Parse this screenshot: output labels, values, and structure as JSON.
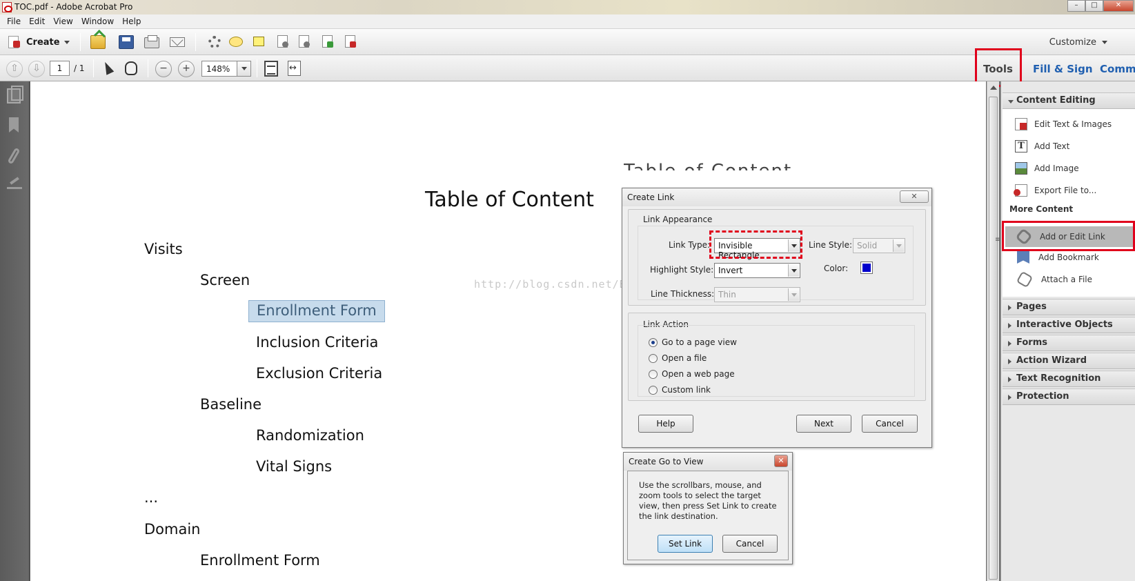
{
  "window": {
    "title": "TOC.pdf - Adobe Acrobat Pro"
  },
  "menu": [
    "File",
    "Edit",
    "View",
    "Window",
    "Help"
  ],
  "toolbar": {
    "create_label": "Create",
    "customize_label": "Customize",
    "icons": [
      "open-folder-icon",
      "save-icon",
      "print-icon",
      "email-icon",
      "settings-icon",
      "comment-icon",
      "highlight-icon",
      "combine-icon",
      "review-icon",
      "share-icon",
      "sign-icon"
    ]
  },
  "nav": {
    "page_current": "1",
    "page_total": "/ 1",
    "zoom": "148%"
  },
  "pane_tabs": {
    "tools": "Tools",
    "fill_sign": "Fill & Sign",
    "comment": "Comm"
  },
  "document": {
    "title": "Table of Content",
    "ghost_heading": "Table of Content",
    "watermark": "http://blog.csdn.net/Bowen_LT",
    "entries": [
      {
        "text": "Visits",
        "level": 0
      },
      {
        "text": "Screen",
        "level": 1
      },
      {
        "text": "Enrollment Form",
        "level": 2,
        "highlighted": true
      },
      {
        "text": "Inclusion Criteria",
        "level": 2
      },
      {
        "text": "Exclusion Criteria",
        "level": 2
      },
      {
        "text": "Baseline",
        "level": 1
      },
      {
        "text": "Randomization",
        "level": 2
      },
      {
        "text": "Vital Signs",
        "level": 2
      },
      {
        "text": "...",
        "level": 0
      },
      {
        "text": "Domain",
        "level": 0
      },
      {
        "text": "Enrollment Form",
        "level": 1
      }
    ]
  },
  "tools_pane": {
    "content_editing": "Content Editing",
    "items": [
      {
        "label": "Edit Text & Images",
        "icon": "edit-text-icon"
      },
      {
        "label": "Add Text",
        "icon": "add-text-icon"
      },
      {
        "label": "Add Image",
        "icon": "add-image-icon"
      },
      {
        "label": "Export File to...",
        "icon": "export-icon"
      }
    ],
    "more_content": "More Content",
    "more_items": [
      {
        "label": "Add or Edit Link",
        "icon": "link-icon",
        "selected": true
      },
      {
        "label": "Add Bookmark",
        "icon": "bookmark-icon"
      },
      {
        "label": "Attach a File",
        "icon": "paperclip-icon"
      }
    ],
    "sections": [
      "Pages",
      "Interactive Objects",
      "Forms",
      "Action Wizard",
      "Text Recognition",
      "Protection"
    ]
  },
  "create_link_dialog": {
    "title": "Create Link",
    "appearance_legend": "Link Appearance",
    "link_type_label": "Link Type:",
    "link_type_value": "Invisible Rectangle",
    "line_style_label": "Line Style:",
    "line_style_value": "Solid",
    "highlight_style_label": "Highlight Style:",
    "highlight_style_value": "Invert",
    "color_label": "Color:",
    "color_value": "#0000cc",
    "line_thickness_label": "Line Thickness:",
    "line_thickness_value": "Thin",
    "action_legend": "Link Action",
    "actions": [
      {
        "label": "Go to a page view",
        "checked": true
      },
      {
        "label": "Open a file",
        "checked": false
      },
      {
        "label": "Open a web page",
        "checked": false
      },
      {
        "label": "Custom link",
        "checked": false
      }
    ],
    "help_button": "Help",
    "next_button": "Next",
    "cancel_button": "Cancel"
  },
  "goto_dialog": {
    "title": "Create Go to View",
    "message": "Use the scrollbars, mouse, and zoom tools to select the target view, then press Set Link to create the link destination.",
    "set_link_button": "Set Link",
    "cancel_button": "Cancel"
  },
  "colors": {
    "annotation_red": "#e0001b",
    "link_blue": "#1f5fb0",
    "highlight": "#c7dbec"
  }
}
